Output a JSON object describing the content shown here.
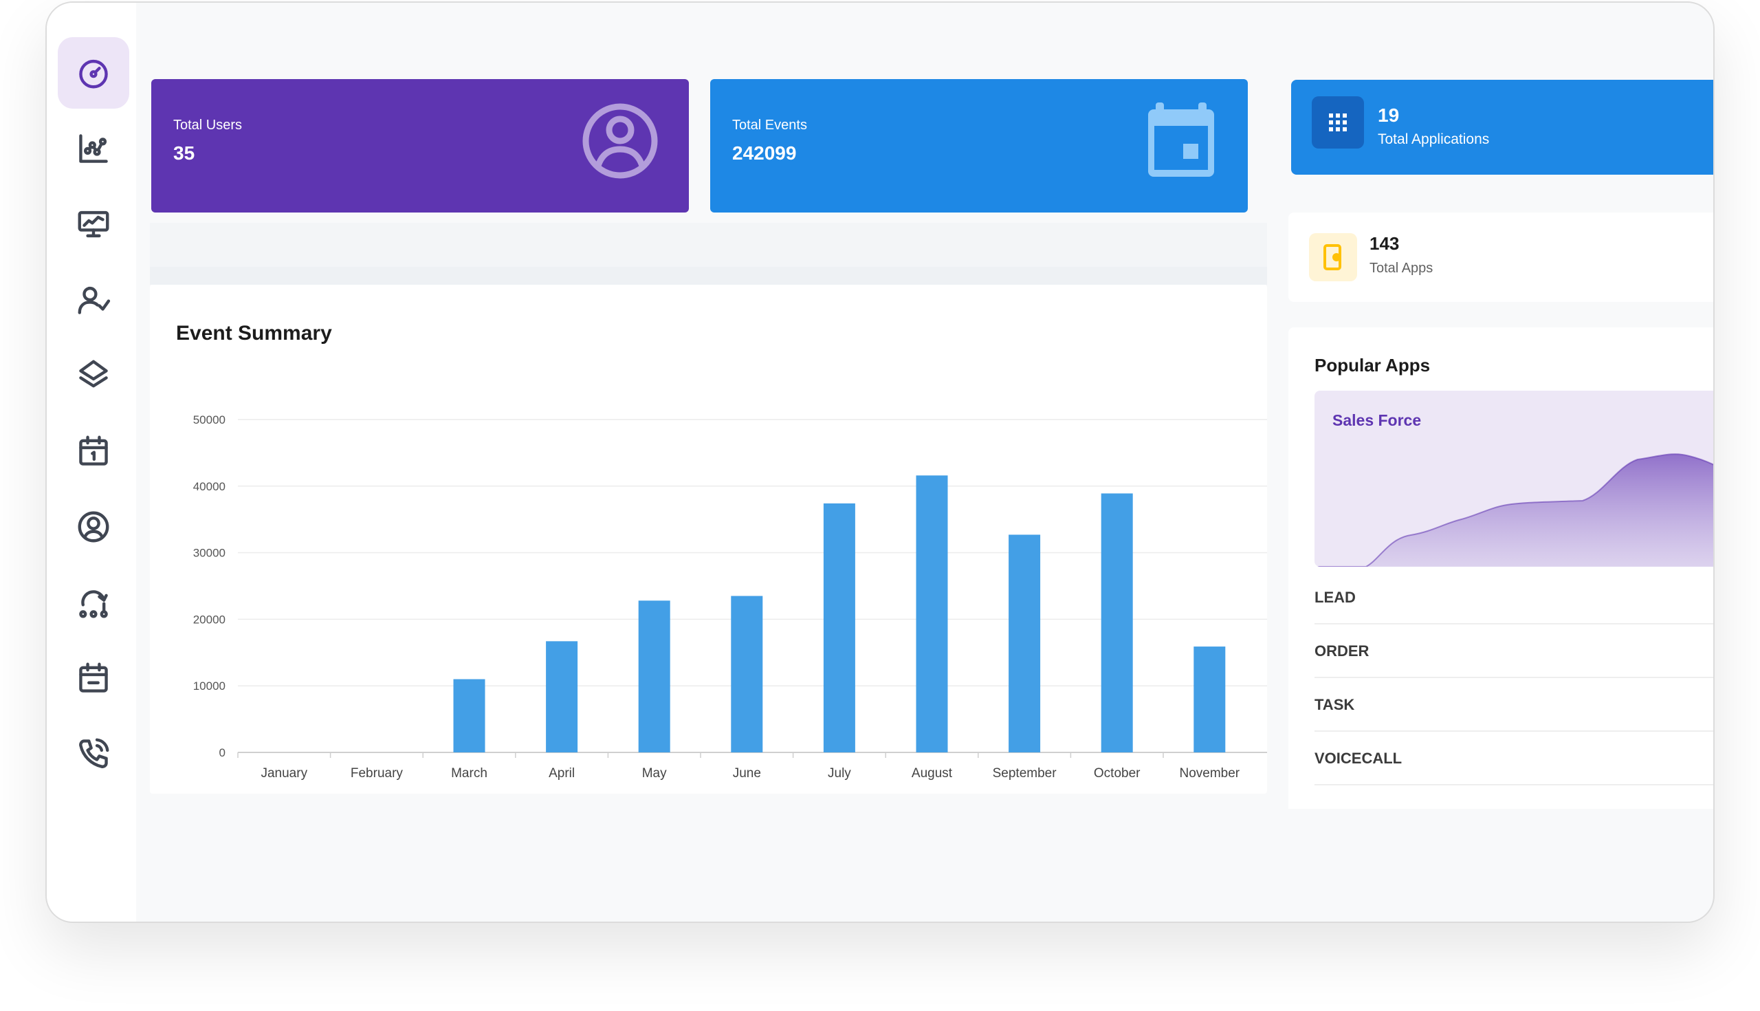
{
  "stats": {
    "users": {
      "label": "Total Users",
      "value": "35"
    },
    "events": {
      "label": "Total Events",
      "value": "242099"
    }
  },
  "applications": {
    "value": "19",
    "label": "Total Applications"
  },
  "total_apps": {
    "value": "143",
    "label": "Total Apps"
  },
  "popular": {
    "title": "Popular Apps",
    "featured": "Sales Force",
    "rows": [
      "LEAD",
      "ORDER",
      "TASK",
      "VOICECALL"
    ]
  },
  "sidebar": {
    "items": [
      "dashboard-icon",
      "analytics-icon",
      "monitor-icon",
      "user-check-icon",
      "layers-icon",
      "calendar-icon",
      "account-icon",
      "workflow-icon",
      "schedule-icon",
      "phone-call-icon"
    ],
    "active": 0
  },
  "colors": {
    "purple": "#5e35b1",
    "blue": "#1e88e5",
    "bar": "#439fe6"
  },
  "chart_data": {
    "type": "bar",
    "title": "Event Summary",
    "categories": [
      "January",
      "February",
      "March",
      "April",
      "May",
      "June",
      "July",
      "August",
      "September",
      "October",
      "November"
    ],
    "series": [
      {
        "values": [
          0,
          0,
          11000,
          16700,
          22800,
          23500,
          37400,
          41600,
          32700,
          38900,
          15900
        ]
      }
    ],
    "y_ticks": [
      0,
      10000,
      20000,
      30000,
      40000,
      50000
    ],
    "ylim": [
      0,
      50000
    ],
    "grid": true,
    "legend": "none"
  }
}
